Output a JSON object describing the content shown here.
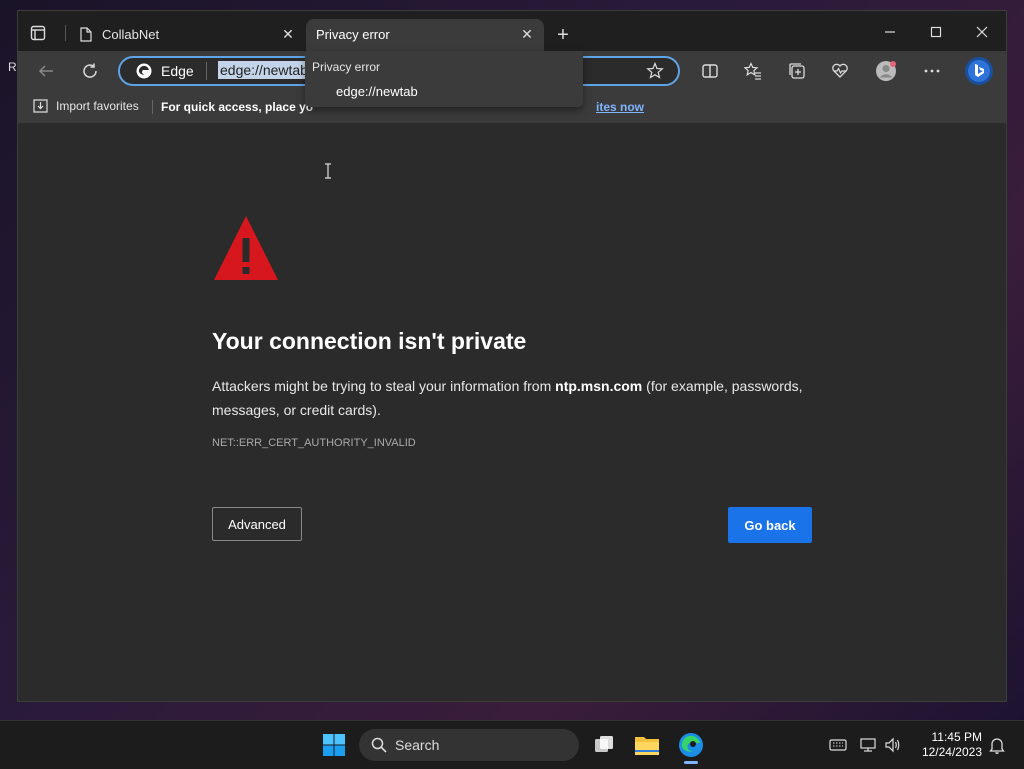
{
  "desktop": {
    "left_text": "R"
  },
  "browser": {
    "tabs": [
      {
        "label": "CollabNet",
        "active": false
      },
      {
        "label": "Privacy error",
        "active": true
      }
    ],
    "new_tab_symbol": "+",
    "address": {
      "site_label": "Edge",
      "url": "edge://newtab"
    },
    "dropdown": {
      "title": "Privacy error",
      "item": "edge://newtab"
    },
    "favorites": {
      "import_label": "Import favorites",
      "hint_text": "For quick access, place yo",
      "link_text": "ites now"
    }
  },
  "page": {
    "title": "Your connection isn't private",
    "desc_before": "Attackers might be trying to steal your information from ",
    "desc_host": "ntp.msn.com",
    "desc_after": " (for example, passwords, messages, or credit cards).",
    "error_code": "NET::ERR_CERT_AUTHORITY_INVALID",
    "advanced_label": "Advanced",
    "go_back_label": "Go back"
  },
  "taskbar": {
    "search_label": "Search",
    "time": "11:45 PM",
    "date": "12/24/2023"
  },
  "colors": {
    "accent": "#1a73e8",
    "warning": "#d6181e",
    "address_focus": "#5ea4e6"
  }
}
